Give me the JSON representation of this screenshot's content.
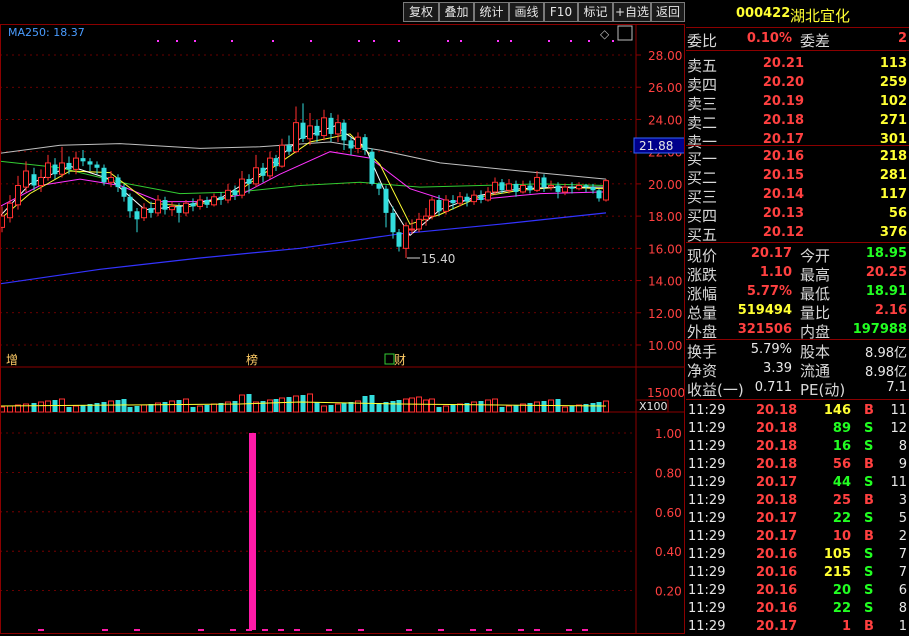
{
  "toolbar": {
    "buttons": [
      "复权",
      "叠加",
      "统计",
      "画线",
      "F10",
      "标记",
      "+自选",
      "返回"
    ]
  },
  "chart": {
    "ma_label": "MA250: 18.37",
    "price_ticks": [
      "28.00",
      "26.00",
      "24.00",
      "22.00",
      "20.00",
      "18.00",
      "16.00",
      "14.00",
      "12.00",
      "10.00"
    ],
    "current_price_tag": "21.88",
    "low_annotation": "15.40",
    "event_labels": [
      "增",
      "榜",
      "财"
    ],
    "volume_tick": "15000",
    "volume_unit": "X100",
    "indicator_ticks": [
      "1.00",
      "0.80",
      "0.60",
      "0.40",
      "0.20"
    ],
    "colors": {
      "up": "#ff3030",
      "down": "#33dddd",
      "ma5": "#ffffff",
      "ma10": "#ffff33",
      "ma20": "#ff33ff",
      "ma60": "#33cc33",
      "ma120": "#c0c0c0",
      "ma250": "#3333ff",
      "indicator": "#ff1aa8"
    }
  },
  "quote": {
    "code": "000422",
    "name": "湖北宜化",
    "weibi_label": "委比",
    "weibi_value": "0.10%",
    "weicha_label": "委差",
    "weicha_value": "2",
    "asks": [
      {
        "label": "卖五",
        "price": "20.21",
        "vol": "113"
      },
      {
        "label": "卖四",
        "price": "20.20",
        "vol": "259"
      },
      {
        "label": "卖三",
        "price": "20.19",
        "vol": "102"
      },
      {
        "label": "卖二",
        "price": "20.18",
        "vol": "271"
      },
      {
        "label": "卖一",
        "price": "20.17",
        "vol": "301"
      }
    ],
    "bids": [
      {
        "label": "买一",
        "price": "20.16",
        "vol": "218"
      },
      {
        "label": "买二",
        "price": "20.15",
        "vol": "281"
      },
      {
        "label": "买三",
        "price": "20.14",
        "vol": "117"
      },
      {
        "label": "买四",
        "price": "20.13",
        "vol": "56"
      },
      {
        "label": "买五",
        "price": "20.12",
        "vol": "376"
      }
    ],
    "stats": [
      {
        "l1": "现价",
        "v1": "20.17",
        "c1": "red",
        "l2": "今开",
        "v2": "18.95",
        "c2": "green"
      },
      {
        "l1": "涨跌",
        "v1": "1.10",
        "c1": "red",
        "l2": "最高",
        "v2": "20.25",
        "c2": "red"
      },
      {
        "l1": "涨幅",
        "v1": "5.77%",
        "c1": "red",
        "l2": "最低",
        "v2": "18.91",
        "c2": "green"
      },
      {
        "l1": "总量",
        "v1": "519494",
        "c1": "yellow",
        "l2": "量比",
        "v2": "2.16",
        "c2": "red"
      },
      {
        "l1": "外盘",
        "v1": "321506",
        "c1": "red",
        "l2": "内盘",
        "v2": "197988",
        "c2": "green"
      }
    ],
    "fin": [
      {
        "l1": "换手",
        "v1": "5.79%",
        "l2": "股本",
        "v2": "8.98亿"
      },
      {
        "l1": "净资",
        "v1": "3.39",
        "l2": "流通",
        "v2": "8.98亿"
      },
      {
        "l1": "收益(一)",
        "v1": "0.711",
        "l2": "PE(动)",
        "v2": "7.1"
      }
    ],
    "ticks": [
      {
        "time": "11:29",
        "price": "20.18",
        "vol": "146",
        "bs": "B",
        "n": "11"
      },
      {
        "time": "11:29",
        "price": "20.18",
        "vol": "89",
        "bs": "S",
        "n": "12"
      },
      {
        "time": "11:29",
        "price": "20.18",
        "vol": "16",
        "bs": "S",
        "n": "8"
      },
      {
        "time": "11:29",
        "price": "20.18",
        "vol": "56",
        "bs": "B",
        "n": "9"
      },
      {
        "time": "11:29",
        "price": "20.17",
        "vol": "44",
        "bs": "S",
        "n": "11"
      },
      {
        "time": "11:29",
        "price": "20.18",
        "vol": "25",
        "bs": "B",
        "n": "3"
      },
      {
        "time": "11:29",
        "price": "20.17",
        "vol": "22",
        "bs": "S",
        "n": "5"
      },
      {
        "time": "11:29",
        "price": "20.17",
        "vol": "10",
        "bs": "B",
        "n": "2"
      },
      {
        "time": "11:29",
        "price": "20.16",
        "vol": "105",
        "bs": "S",
        "n": "7"
      },
      {
        "time": "11:29",
        "price": "20.16",
        "vol": "215",
        "bs": "S",
        "n": "7"
      },
      {
        "time": "11:29",
        "price": "20.16",
        "vol": "20",
        "bs": "S",
        "n": "6"
      },
      {
        "time": "11:29",
        "price": "20.16",
        "vol": "22",
        "bs": "S",
        "n": "8"
      },
      {
        "time": "11:29",
        "price": "20.17",
        "vol": "1",
        "bs": "B",
        "n": "1"
      }
    ]
  }
}
